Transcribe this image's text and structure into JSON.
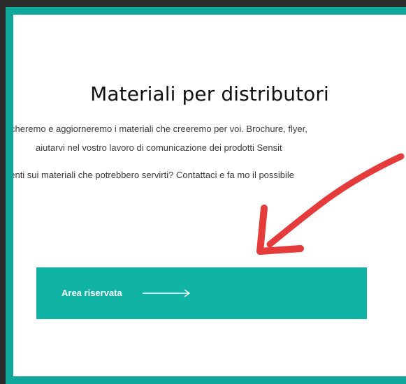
{
  "colors": {
    "frame": "#10a79b",
    "page_background": "#2b2b2b",
    "button": "#11b3a5",
    "annotation_arrow": "#e63b3b"
  },
  "page": {
    "title": "Materiali per distributori",
    "paragraphs": [
      "cheremo e aggiorneremo i materiali che creeremo per voi. Brochure, flyer,",
      "aiutarvi nel vostro lavoro di comunicazione dei prodotti Sensit",
      "nenti sui materiali che potrebbero servirti? Contattaci e fa    mo il possibile"
    ]
  },
  "cta": {
    "label": "Area riservata",
    "arrow_icon": "long-right-arrow-icon"
  },
  "annotation": {
    "icon": "curved-red-arrow-icon"
  }
}
